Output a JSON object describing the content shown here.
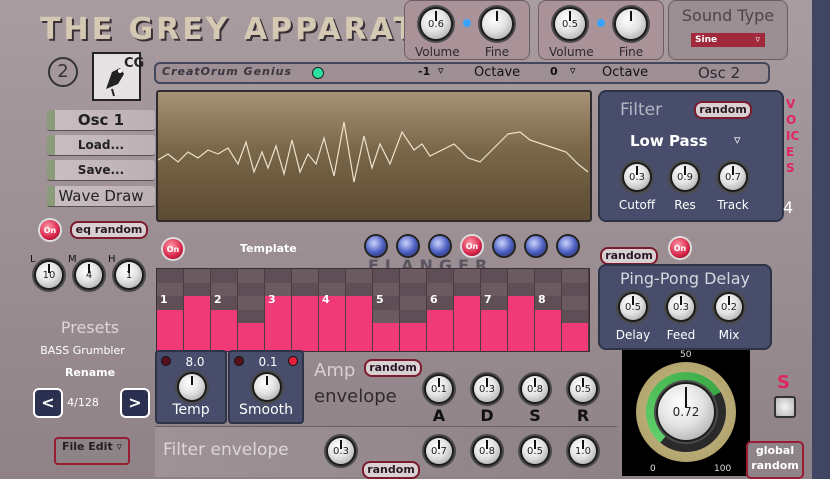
{
  "app": {
    "title": "THE GREY APPARATUS",
    "osc_number": "2",
    "logo_letters": "CG",
    "brand": "CreatOrum Genius",
    "osc_label": "Osc 2"
  },
  "osc_top": [
    {
      "volume_label": "Volume",
      "volume_value": "0.6",
      "fine_label": "Fine"
    },
    {
      "volume_label": "Volume",
      "volume_value": "0.5",
      "fine_label": "Fine"
    }
  ],
  "octave": [
    {
      "value": "-1",
      "label": "Octave"
    },
    {
      "value": "0",
      "label": "Octave"
    }
  ],
  "sound_type": {
    "title": "Sound Type",
    "value": "Sine"
  },
  "left_buttons": [
    "Osc 1",
    "Load...",
    "Save...",
    "Wave Draw"
  ],
  "eq": {
    "on_label": "On",
    "random_label": "eq random",
    "knobs": [
      {
        "label": "L",
        "value": "10"
      },
      {
        "label": "M",
        "value": "4"
      },
      {
        "label": "H",
        "value": "1"
      }
    ]
  },
  "filter": {
    "title": "Filter",
    "random_label": "random",
    "type": "Low Pass",
    "knobs": [
      {
        "label": "Cutoff",
        "value": "0.3"
      },
      {
        "label": "Res",
        "value": "0.9"
      },
      {
        "label": "Track",
        "value": "0.7"
      }
    ]
  },
  "voices": {
    "label": "VOICES",
    "count": "4"
  },
  "sequencer": {
    "on_label": "On",
    "template_label": "Template",
    "random_label": "random",
    "flanger_label": "FLANGER",
    "step_numbers": [
      "1",
      "2",
      "3",
      "4",
      "5",
      "6",
      "7",
      "8"
    ]
  },
  "delay": {
    "title": "Ping-Pong Delay",
    "knobs": [
      {
        "label": "Delay",
        "value": "0.5"
      },
      {
        "label": "Feed",
        "value": "0.3"
      },
      {
        "label": "Mix",
        "value": "0.2"
      }
    ]
  },
  "presets": {
    "title": "Presets",
    "name": "BASS Grumbler",
    "rename_label": "Rename",
    "prev": "<",
    "next": ">",
    "counter": "4/128",
    "file_edit": "File Edit"
  },
  "temp": {
    "value": "8.0",
    "label": "Temp"
  },
  "smooth": {
    "value": "0.1",
    "label": "Smooth"
  },
  "amp_env": {
    "title": "Amp",
    "subtitle": "envelope",
    "random_label": "random",
    "knobs": [
      {
        "label": "A",
        "value": "0.1"
      },
      {
        "label": "D",
        "value": "0.3"
      },
      {
        "label": "S",
        "value": "0.8"
      },
      {
        "label": "R",
        "value": "0.5"
      }
    ]
  },
  "filter_env": {
    "title": "Filter envelope",
    "random_label": "random",
    "knob_values": [
      "0.3",
      "0.7",
      "0.8",
      "0.5",
      "1.0"
    ]
  },
  "master": {
    "value": "0.72",
    "scale_min": "0",
    "scale_max": "100",
    "scale_top": "50"
  },
  "s_label": "S",
  "global_random": "global random",
  "colors": {
    "accent": "#e0245e",
    "panel_navy": "#474d6a",
    "body": "#8a7d80",
    "display": "#6d5a3f"
  }
}
